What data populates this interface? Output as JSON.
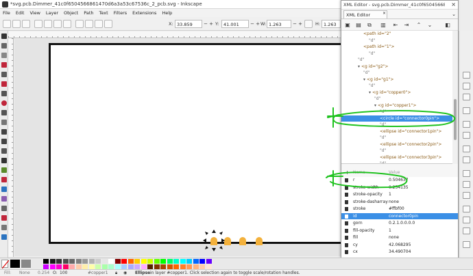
{
  "window": {
    "title": "*svg.pcb.Dimmer_41c0f6504566861470d6a3a53c67536c_2_pcb.svg - Inkscape"
  },
  "menu": [
    "File",
    "Edit",
    "View",
    "Layer",
    "Object",
    "Path",
    "Text",
    "Filters",
    "Extensions",
    "Help"
  ],
  "toolbar": {
    "x_label": "X:",
    "x_value": "33.859",
    "y_label": "Y:",
    "y_value": "41.001",
    "w_label": "W:",
    "w_value": "1.263",
    "h_label": "H:",
    "h_value": "1.263"
  },
  "xml_editor": {
    "title": "XML Editor - svg.pcb.Dimmer_41c0f6504566861470d6a...",
    "tab_label": "XML Editor",
    "tab_close": "×",
    "close": "×",
    "tree": [
      {
        "text": "<path id=\"2\"",
        "depth": 2,
        "kind": "tag"
      },
      {
        "text": "\"d\"",
        "depth": 3,
        "kind": "q"
      },
      {
        "text": "<path id=\"1\">",
        "depth": 2,
        "kind": "tag"
      },
      {
        "text": "\"d\"",
        "depth": 3,
        "kind": "q"
      },
      {
        "text": "\"d\"",
        "depth": 1,
        "kind": "q"
      },
      {
        "text": "<g id=\"g2\">",
        "depth": 1,
        "kind": "tag",
        "arrow": "▾"
      },
      {
        "text": "\"d\"",
        "depth": 2,
        "kind": "q"
      },
      {
        "text": "<g id=\"g1\">",
        "depth": 2,
        "kind": "tag",
        "arrow": "▾"
      },
      {
        "text": "\"d\"",
        "depth": 3,
        "kind": "q"
      },
      {
        "text": "<g id=\"copper0\">",
        "depth": 3,
        "kind": "tag",
        "arrow": "▾"
      },
      {
        "text": "\"d\"",
        "depth": 4,
        "kind": "q"
      },
      {
        "text": "<g id=\"copper1\">",
        "depth": 4,
        "kind": "tag",
        "arrow": "▾"
      },
      {
        "text": "\"d\"",
        "depth": 5,
        "kind": "q"
      },
      {
        "text": "<circle id=\"connector0pin\">",
        "depth": 5,
        "kind": "tag",
        "selected": true
      },
      {
        "text": "\"d\"",
        "depth": 5,
        "kind": "q"
      },
      {
        "text": "<ellipse id=\"connector1pin\">",
        "depth": 5,
        "kind": "tag"
      },
      {
        "text": "\"d\"",
        "depth": 5,
        "kind": "q"
      },
      {
        "text": "<ellipse id=\"connector2pin\">",
        "depth": 5,
        "kind": "tag"
      },
      {
        "text": "\"d\"",
        "depth": 5,
        "kind": "q"
      },
      {
        "text": "<ellipse id=\"connector3pin\">",
        "depth": 5,
        "kind": "tag"
      },
      {
        "text": "\"d\"",
        "depth": 5,
        "kind": "q"
      }
    ],
    "attr_header": {
      "name": "Name",
      "value": "Value"
    },
    "attributes": [
      {
        "name": "r",
        "value": "0.504637"
      },
      {
        "name": "stroke-width",
        "value": "0.254135"
      },
      {
        "name": "stroke-opacity",
        "value": "1"
      },
      {
        "name": "stroke-dasharray",
        "value": "none"
      },
      {
        "name": "stroke",
        "value": "#ffbf00"
      },
      {
        "name": "id",
        "value": "connector0pin",
        "selected": true
      },
      {
        "name": "gorn",
        "value": "0.2.1.0.0.0.0"
      },
      {
        "name": "fill-opacity",
        "value": "1"
      },
      {
        "name": "fill",
        "value": "none"
      },
      {
        "name": "cy",
        "value": "42.068295"
      },
      {
        "name": "cx",
        "value": "34.490704"
      }
    ]
  },
  "statusbar": {
    "fill_label": "Fill:",
    "fill_value": "None",
    "stroke_value": "0.254",
    "opacity_label": "O:",
    "opacity_value": "100",
    "layer": "#copper1",
    "message_bold": "Ellipse",
    "message": " in layer #copper1. Click selection again to toggle scale/rotation handles."
  },
  "colors": {
    "accent_selection": "#3b8fe6",
    "annotation_green": "#1fc21f",
    "pin_orange": "#f3b13c"
  },
  "palette": [
    "#000000",
    "#1a1a1a",
    "#333333",
    "#4d4d4d",
    "#666666",
    "#808080",
    "#999999",
    "#b3b3b3",
    "#cccccc",
    "#e6e6e6",
    "#ffffff",
    "#800000",
    "#ff0000",
    "#ff6600",
    "#ffcc00",
    "#ffff00",
    "#ccff00",
    "#66ff00",
    "#00ff00",
    "#00ff66",
    "#00ffcc",
    "#00ffff",
    "#00ccff",
    "#0066ff",
    "#0000ff",
    "#6600ff",
    "#cc00ff",
    "#ff00ff",
    "#ff00cc",
    "#ff0066",
    "#ffaaaa",
    "#ffccaa",
    "#ffeeaa",
    "#ffffaa",
    "#ccffaa",
    "#aaffaa",
    "#aaffcc",
    "#aaffff",
    "#aaccff",
    "#aaaaff",
    "#ccaaff",
    "#ffaaff",
    "#552200",
    "#803300",
    "#aa4400",
    "#d45500",
    "#ff6600",
    "#ff7f2a",
    "#ff9955",
    "#ffb380",
    "#ffccaa",
    "#ffe6d5"
  ]
}
